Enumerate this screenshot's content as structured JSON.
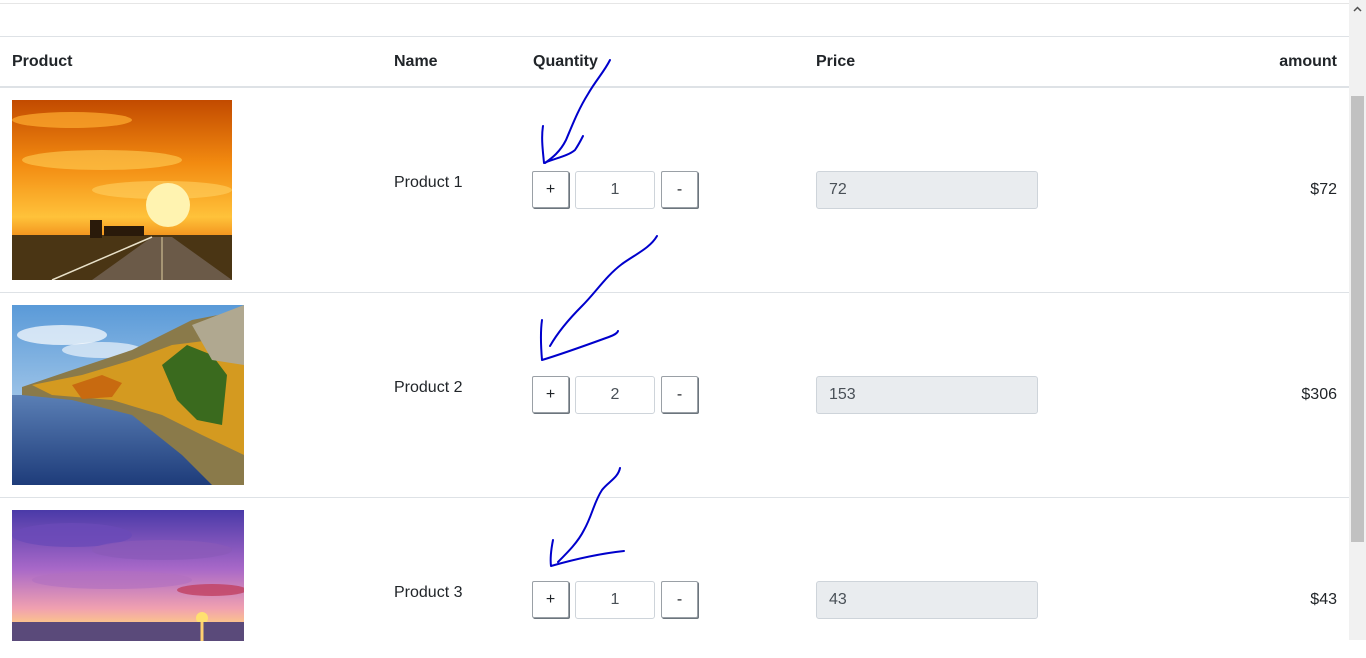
{
  "table": {
    "headers": {
      "product": "Product",
      "name": "Name",
      "quantity": "Quantity",
      "price": "Price",
      "amount": "amount"
    },
    "rows": [
      {
        "image": "sunset-road-photo",
        "name": "Product 1",
        "quantity": "1",
        "price": "72",
        "amount": "$72"
      },
      {
        "image": "autumn-river-photo",
        "name": "Product 2",
        "quantity": "2",
        "price": "153",
        "amount": "$306"
      },
      {
        "image": "purple-sky-sunset-photo",
        "name": "Product 3",
        "quantity": "1",
        "price": "43",
        "amount": "$43"
      }
    ],
    "plus_label": "+",
    "minus_label": "-"
  },
  "annotations": {
    "type": "hand-drawn arrows",
    "color": "#0000cc",
    "count": 3
  },
  "icons": {
    "scroll_up": "chevron-up-icon"
  }
}
